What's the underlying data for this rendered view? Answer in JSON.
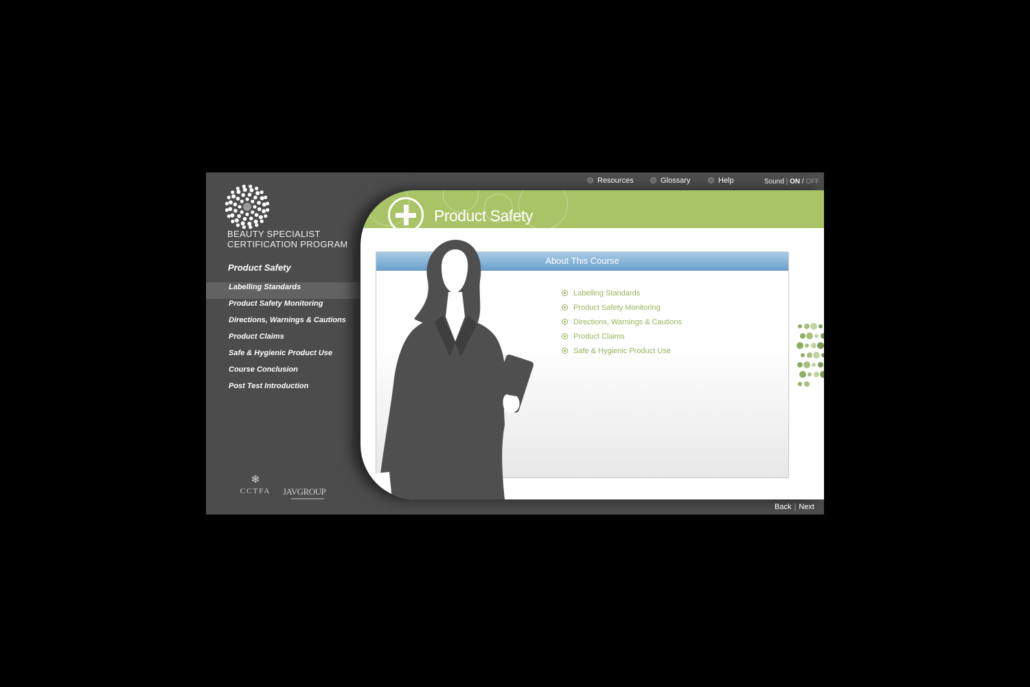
{
  "brand": {
    "line1": "BEAUTY SPECIALIST",
    "line2": "CERTIFICATION PROGRAM"
  },
  "sidebar": {
    "title": "Product Safety",
    "items": [
      {
        "label": "Labelling Standards"
      },
      {
        "label": "Product Safety Monitoring"
      },
      {
        "label": "Directions, Warnings & Cautions"
      },
      {
        "label": "Product Claims"
      },
      {
        "label": "Safe & Hygienic Product Use"
      },
      {
        "label": "Course Conclusion"
      },
      {
        "label": "Post Test Introduction"
      }
    ],
    "active_index": 0
  },
  "sponsors": {
    "cctfa": "CCTFA",
    "javgroup": "JAVGROUP"
  },
  "topnav": {
    "resources": "Resources",
    "glossary": "Glossary",
    "help": "Help"
  },
  "sound": {
    "label": "Sound",
    "on": "ON",
    "slash": "/",
    "off": "OFF"
  },
  "main": {
    "title": "Product Safety",
    "box_title": "About This Course",
    "topics": [
      "Labelling Standards",
      "Product Safety Monitoring",
      "Directions, Warnings & Cautions",
      "Product Claims",
      "Safe & Hygienic Product Use"
    ]
  },
  "footer": {
    "back": "Back",
    "next": "Next"
  },
  "colors": {
    "sidebar_bg": "#4c4c4d",
    "banner_green": "#a9c467",
    "header_blue": "#6aa1cd",
    "topic_green": "#98b45a"
  }
}
